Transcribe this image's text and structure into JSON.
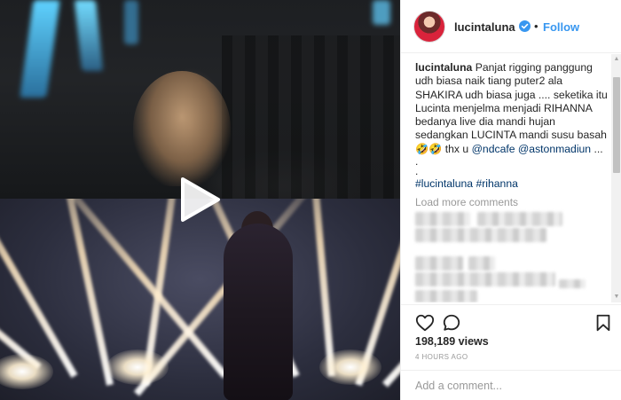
{
  "media": {
    "play_icon": "play-icon"
  },
  "header": {
    "username": "lucintaluna",
    "verified_icon": "verified-badge-icon",
    "separator": "•",
    "follow_label": "Follow"
  },
  "caption": {
    "username": "lucintaluna",
    "text": "Panjat rigging panggung udh biasa naik tiang puter2 ala SHAKIRA udh biasa juga .... seketika itu Lucinta menjelma menjadi RIHANNA bedanya live dia mandi hujan sedangkan LUCINTA mandi susu basah ",
    "emoji": "🤣🤣",
    "thanks": " thx u ",
    "mention1": "@ndcafe",
    "mention2": "@astonmadiun",
    "ellipsis": " ...",
    "bullet1": ".",
    "bullet2": ".",
    "hashtag1": "#lucintaluna",
    "hashtag2": "#rihanna"
  },
  "comments": {
    "load_more_label": "Load more comments"
  },
  "actions": {
    "like_icon": "heart-icon",
    "comment_icon": "comment-bubble-icon",
    "save_icon": "bookmark-icon"
  },
  "stats": {
    "views": "198,189 views",
    "time_ago": "4 HOURS AGO"
  },
  "add_comment": {
    "placeholder": "Add a comment..."
  },
  "colors": {
    "link": "#003569",
    "follow": "#3897f0",
    "muted": "#999999",
    "text": "#262626"
  }
}
